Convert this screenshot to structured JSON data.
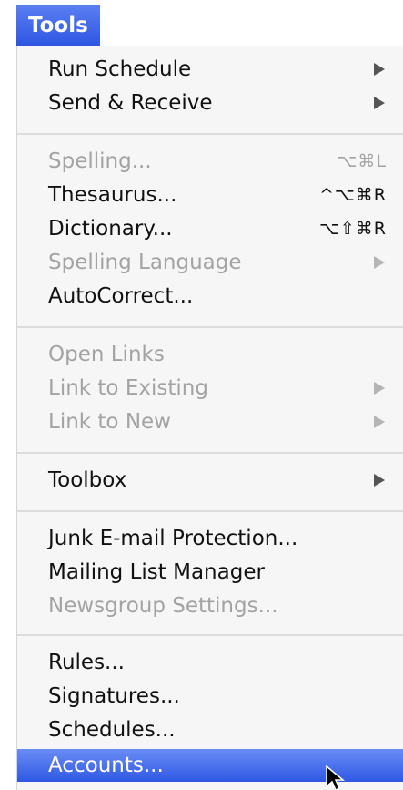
{
  "menu_title": "Tools",
  "items": [
    {
      "label": "Run Schedule",
      "shortcut": "",
      "submenu": true,
      "enabled": true
    },
    {
      "label": "Send & Receive",
      "shortcut": "",
      "submenu": true,
      "enabled": true
    },
    {
      "label": "Spelling...",
      "shortcut": "⌥⌘L",
      "submenu": false,
      "enabled": false
    },
    {
      "label": "Thesaurus...",
      "shortcut": "^⌥⌘R",
      "submenu": false,
      "enabled": true
    },
    {
      "label": "Dictionary...",
      "shortcut": "⌥⇧⌘R",
      "submenu": false,
      "enabled": true
    },
    {
      "label": "Spelling Language",
      "shortcut": "",
      "submenu": true,
      "enabled": false
    },
    {
      "label": "AutoCorrect...",
      "shortcut": "",
      "submenu": false,
      "enabled": true
    },
    {
      "label": "Open Links",
      "shortcut": "",
      "submenu": false,
      "enabled": false
    },
    {
      "label": "Link to Existing",
      "shortcut": "",
      "submenu": true,
      "enabled": false
    },
    {
      "label": "Link to New",
      "shortcut": "",
      "submenu": true,
      "enabled": false
    },
    {
      "label": "Toolbox",
      "shortcut": "",
      "submenu": true,
      "enabled": true
    },
    {
      "label": "Junk E-mail Protection...",
      "shortcut": "",
      "submenu": false,
      "enabled": true
    },
    {
      "label": "Mailing List Manager",
      "shortcut": "",
      "submenu": false,
      "enabled": true
    },
    {
      "label": "Newsgroup Settings...",
      "shortcut": "",
      "submenu": false,
      "enabled": false
    },
    {
      "label": "Rules...",
      "shortcut": "",
      "submenu": false,
      "enabled": true
    },
    {
      "label": "Signatures...",
      "shortcut": "",
      "submenu": false,
      "enabled": true
    },
    {
      "label": "Schedules...",
      "shortcut": "",
      "submenu": false,
      "enabled": true
    },
    {
      "label": "Accounts...",
      "shortcut": "",
      "submenu": false,
      "enabled": true,
      "highlighted": true
    }
  ],
  "colors": {
    "highlight": "#3a62e8",
    "disabled_text": "#a3a3a3",
    "menu_background": "#f6f6f6"
  }
}
